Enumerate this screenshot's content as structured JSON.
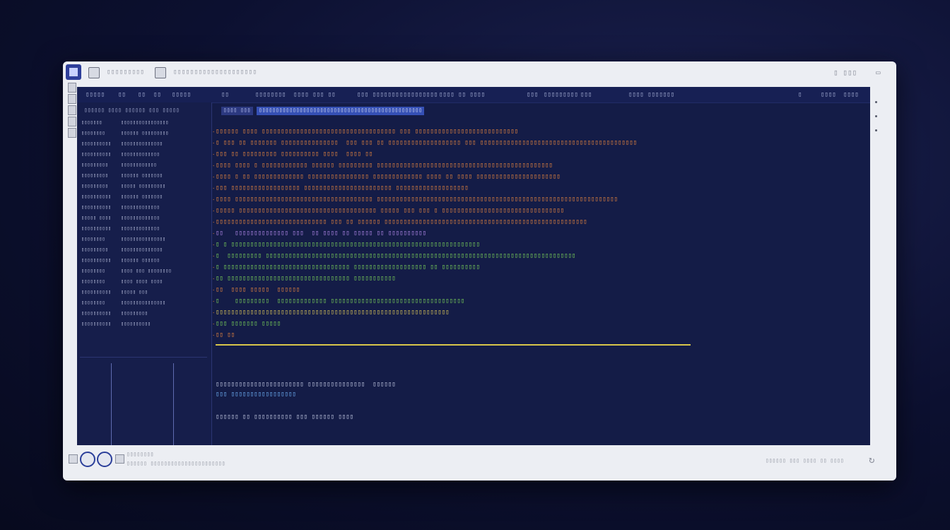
{
  "window": {
    "title_tabs": [
      "▯▯▯▯▯▯▯▯▯",
      "▯▯▯▯▯▯▯▯▯▯▯▯▯▯▯▯▯▯▯▯"
    ],
    "controls": [
      "▯ ▯▯▯"
    ]
  },
  "editor": {
    "topbar": {
      "menu_left": [
        "▯▯▯▯▯",
        "▯▯",
        "▯▯",
        "▯▯",
        "▯▯▯▯▯"
      ],
      "menu_mid": [
        "▯▯",
        "▯▯▯▯▯▯▯▯",
        "▯▯▯▯ ▯▯▯ ▯▯",
        "▯▯▯ ▯▯▯▯▯▯▯",
        "▯▯▯▯▯▯▯▯▯▯",
        "▯▯▯▯ ▯▯ ▯▯▯▯",
        "▯▯▯",
        "▯▯▯▯▯▯▯▯▯",
        "▯▯▯",
        "▯▯▯▯ ▯▯▯▯▯▯▯"
      ],
      "menu_right": [
        "▯",
        "▯▯▯▯",
        "▯▯▯▯"
      ]
    },
    "sidebar": {
      "header": "▯▯▯▯▯▯ ▯▯▯▯ ▯▯▯▯▯▯ ▯▯▯ ▯▯▯▯▯",
      "files": [
        {
          "name": "▯▯▯▯▯▯▯",
          "meta": "▯▯▯▯▯▯▯▯▯▯▯▯▯▯▯▯"
        },
        {
          "name": "▯▯▯▯▯▯▯▯",
          "meta": "▯▯▯▯▯▯ ▯▯▯▯▯▯▯▯▯"
        },
        {
          "name": "▯▯▯▯▯▯▯▯▯▯",
          "meta": "▯▯▯▯▯▯▯▯▯▯▯▯▯▯"
        },
        {
          "name": "▯▯▯▯▯▯▯▯▯▯",
          "meta": "▯▯▯▯▯▯▯▯▯▯▯▯▯"
        },
        {
          "name": "▯▯▯▯▯▯▯▯▯",
          "meta": "▯▯▯▯▯▯▯▯▯▯▯▯"
        },
        {
          "name": "▯▯▯▯▯▯▯▯▯",
          "meta": "▯▯▯▯▯▯ ▯▯▯▯▯▯▯"
        },
        {
          "name": "▯▯▯▯▯▯▯▯▯",
          "meta": "▯▯▯▯▯ ▯▯▯▯▯▯▯▯▯"
        },
        {
          "name": "▯▯▯▯▯▯▯▯▯▯",
          "meta": "▯▯▯▯▯▯ ▯▯▯▯▯▯▯"
        },
        {
          "name": "▯▯▯▯▯▯▯▯▯▯",
          "meta": "▯▯▯▯▯▯▯▯▯▯▯▯▯"
        },
        {
          "name": "▯▯▯▯▯ ▯▯▯▯",
          "meta": "▯▯▯▯▯▯▯▯▯▯▯▯▯"
        },
        {
          "name": "▯▯▯▯▯▯▯▯▯▯",
          "meta": "▯▯▯▯▯▯▯▯▯▯▯▯▯"
        },
        {
          "name": "▯▯▯▯▯▯▯▯",
          "meta": "▯▯▯▯▯▯▯▯▯▯▯▯▯▯▯"
        },
        {
          "name": "▯▯▯▯▯▯▯▯▯",
          "meta": "▯▯▯▯▯▯▯▯▯▯▯▯▯▯"
        },
        {
          "name": "▯▯▯▯▯▯▯▯▯▯",
          "meta": "▯▯▯▯▯▯ ▯▯▯▯▯▯"
        },
        {
          "name": "▯▯▯▯▯▯▯▯",
          "meta": "▯▯▯▯ ▯▯▯ ▯▯▯▯▯▯▯▯"
        },
        {
          "name": "▯▯▯▯▯▯▯▯",
          "meta": "▯▯▯▯ ▯▯▯▯ ▯▯▯▯"
        },
        {
          "name": "▯▯▯▯▯▯▯▯▯▯",
          "meta": "▯▯▯▯▯ ▯▯▯"
        },
        {
          "name": "▯▯▯▯▯▯▯▯",
          "meta": "▯▯▯▯▯▯▯▯▯▯▯▯▯▯▯"
        },
        {
          "name": "▯▯▯▯▯▯▯▯▯▯",
          "meta": "▯▯▯▯▯▯▯▯▯"
        },
        {
          "name": "▯▯▯▯▯▯▯▯▯▯",
          "meta": "▯▯▯▯▯▯▯▯▯▯"
        }
      ]
    },
    "tabs": [
      {
        "label": "▯▯▯▯ ▯▯▯"
      },
      {
        "label": "▯▯▯▯▯▯▯▯▯▯▯▯▯▯▯▯▯▯▯▯▯▯▯▯▯▯▯▯▯▯▯▯▯▯▯▯▯▯▯▯▯▯▯▯▯▯▯▯"
      }
    ],
    "code": [
      {
        "cls": "o",
        "text": "▯▯▯▯▯▯ ▯▯▯▯ ▯▯▯▯▯▯▯▯▯▯▯▯▯▯▯▯▯▯▯▯▯▯▯▯▯▯▯▯▯▯▯▯▯▯▯ ▯▯▯ ▯▯▯▯▯▯▯▯▯▯▯▯▯▯▯▯▯▯▯▯▯▯▯▯▯▯▯"
      },
      {
        "cls": "o",
        "text": "▯ ▯▯▯ ▯▯ ▯▯▯▯▯▯▯ ▯▯▯▯▯▯▯▯▯▯▯▯▯▯▯  ▯▯▯ ▯▯▯ ▯▯ ▯▯▯▯▯▯▯▯▯▯▯▯▯▯▯▯▯▯▯ ▯▯▯ ▯▯▯▯▯▯▯▯▯▯▯▯▯▯▯▯▯▯▯▯▯▯▯▯▯▯▯▯▯▯▯▯▯▯▯▯▯▯▯▯▯"
      },
      {
        "cls": "o",
        "text": "▯▯▯ ▯▯ ▯▯▯▯▯▯▯▯▯ ▯▯▯▯▯▯▯▯▯▯ ▯▯▯▯  ▯▯▯▯ ▯▯"
      },
      {
        "cls": "o",
        "text": "▯▯▯▯ ▯▯▯▯ ▯ ▯▯▯▯▯▯▯▯▯▯▯▯ ▯▯▯▯▯▯ ▯▯▯▯▯▯▯▯▯ ▯▯▯▯▯▯▯▯▯▯▯▯▯▯▯▯▯▯▯▯▯▯▯▯▯▯▯▯▯▯▯▯▯▯▯▯▯▯▯▯▯▯▯▯▯▯"
      },
      {
        "cls": "o",
        "text": "▯▯▯▯ ▯ ▯▯ ▯▯▯▯▯▯▯▯▯▯▯▯▯ ▯▯▯▯▯▯▯▯▯▯▯▯▯▯▯▯ ▯▯▯▯▯▯▯▯▯▯▯▯▯ ▯▯▯▯ ▯▯ ▯▯▯▯ ▯▯▯▯▯▯▯▯▯▯▯▯▯▯▯▯▯▯▯▯▯▯"
      },
      {
        "cls": "o",
        "text": "▯▯▯ ▯▯▯▯▯▯▯▯▯▯▯▯▯▯▯▯▯▯ ▯▯▯▯▯▯▯▯▯▯▯▯▯▯▯▯▯▯▯▯▯▯▯ ▯▯▯▯▯▯▯▯▯▯▯▯▯▯▯▯▯▯▯"
      },
      {
        "cls": "o",
        "text": "▯▯▯▯ ▯▯▯▯▯▯▯▯▯▯▯▯▯▯▯▯▯▯▯▯▯▯▯▯▯▯▯▯▯▯▯▯▯▯▯▯ ▯▯▯▯▯▯▯▯▯▯▯▯▯▯▯▯▯▯▯▯▯▯▯▯▯▯▯▯▯▯▯▯▯▯▯▯▯▯▯▯▯▯▯▯▯▯▯▯▯▯▯▯▯▯▯▯▯▯▯▯▯▯▯"
      },
      {
        "cls": "o",
        "text": "▯▯▯▯▯ ▯▯▯▯▯▯▯▯▯▯▯▯▯▯▯▯▯▯▯▯▯▯▯▯▯▯▯▯▯▯▯▯▯▯▯▯ ▯▯▯▯▯ ▯▯▯ ▯▯▯ ▯ ▯▯▯▯▯▯▯▯▯▯▯▯▯▯▯▯▯▯▯▯▯▯▯▯▯▯▯▯▯▯▯▯"
      },
      {
        "cls": "o",
        "text": "▯▯▯▯▯▯▯▯▯▯▯▯▯▯▯▯▯▯▯▯▯▯▯▯▯▯▯▯▯ ▯▯▯ ▯▯ ▯▯▯▯▯▯ ▯▯▯▯▯▯▯▯▯▯▯▯▯▯▯▯▯▯▯▯▯▯▯▯▯▯▯▯▯▯▯▯▯▯▯▯▯▯▯▯▯▯▯▯▯▯▯▯▯▯▯▯▯"
      },
      {
        "cls": "p",
        "text": "▯▯   ▯▯▯▯▯▯▯▯▯▯▯▯▯▯ ▯▯▯  ▯▯ ▯▯▯▯ ▯▯ ▯▯▯▯▯ ▯▯ ▯▯▯▯▯▯▯▯▯▯"
      },
      {
        "cls": "g",
        "text": "▯ ▯ ▯▯▯▯▯▯▯▯▯▯▯▯▯▯▯▯▯▯▯▯▯▯▯▯▯▯▯▯▯▯▯▯▯▯▯▯▯▯▯▯▯▯▯▯▯▯▯▯▯▯▯▯▯▯▯▯▯▯▯▯▯▯▯▯▯"
      },
      {
        "cls": "g",
        "text": "▯  ▯▯▯▯▯▯▯▯▯ ▯▯▯▯▯▯▯▯▯▯▯▯▯▯▯▯▯▯▯▯▯▯▯▯▯▯▯▯▯▯▯▯▯▯▯▯▯▯▯▯▯▯▯▯▯▯▯▯▯▯▯▯▯▯▯▯▯▯▯▯▯▯▯▯▯▯▯▯▯▯▯▯▯▯▯▯▯▯▯▯▯"
      },
      {
        "cls": "g",
        "text": "▯ ▯▯▯▯▯▯▯▯▯▯▯▯▯▯▯▯▯▯▯▯▯▯▯▯▯▯▯▯▯▯▯▯▯ ▯▯▯▯▯▯▯▯▯▯▯▯▯▯▯▯▯▯▯ ▯▯ ▯▯▯▯▯▯▯▯▯▯"
      },
      {
        "cls": "g",
        "text": "▯▯ ▯▯▯▯▯▯▯▯▯▯▯▯▯▯▯▯▯▯▯▯▯▯▯▯▯▯▯▯▯▯▯▯ ▯▯▯▯▯▯▯▯▯▯▯"
      },
      {
        "cls": "o",
        "text": "▯▯  ▯▯▯▯ ▯▯▯▯▯  ▯▯▯▯▯▯"
      },
      {
        "cls": "g",
        "text": "▯    ▯▯▯▯▯▯▯▯▯  ▯▯▯▯▯▯▯▯▯▯▯▯▯ ▯▯▯▯▯▯▯▯▯▯▯▯▯▯▯▯▯▯▯▯▯▯▯▯▯▯▯▯▯▯▯▯▯▯▯"
      },
      {
        "cls": "y",
        "text": "▯▯▯▯▯▯▯▯▯▯▯▯▯▯▯▯▯▯▯▯▯▯▯▯▯▯▯▯▯▯▯▯▯▯▯▯▯▯▯▯▯▯▯▯▯▯▯▯▯▯▯▯▯▯▯▯▯▯▯▯▯"
      },
      {
        "cls": "g",
        "text": "▯▯▯ ▯▯▯▯▯▯▯ ▯▯▯▯▯"
      },
      {
        "cls": "o",
        "text": "▯▯ ▯▯"
      }
    ],
    "footer_lines": [
      "▯▯▯▯▯▯▯▯▯▯▯▯▯▯▯▯▯▯▯▯▯▯▯ ▯▯▯▯▯▯▯▯▯▯▯▯▯▯▯  ▯▯▯▯▯▯",
      "▯▯▯ ▯▯▯▯▯▯▯▯▯▯▯▯▯▯▯▯▯",
      "▯▯▯▯▯▯ ▯▯ ▯▯▯▯▯▯▯▯▯▯ ▯▯▯ ▯▯▯▯▯▯ ▯▯▯▯"
    ]
  },
  "statusbar": {
    "left_label": "▯▯▯▯▯▯▯▯",
    "left_path": "▯▯▯▯▯▯ ▯▯▯▯▯▯▯▯▯▯▯▯▯▯▯▯▯▯▯▯▯▯",
    "right_info": "▯▯▯▯▯▯ ▯▯▯ ▯▯▯▯ ▯▯ ▯▯▯▯"
  }
}
